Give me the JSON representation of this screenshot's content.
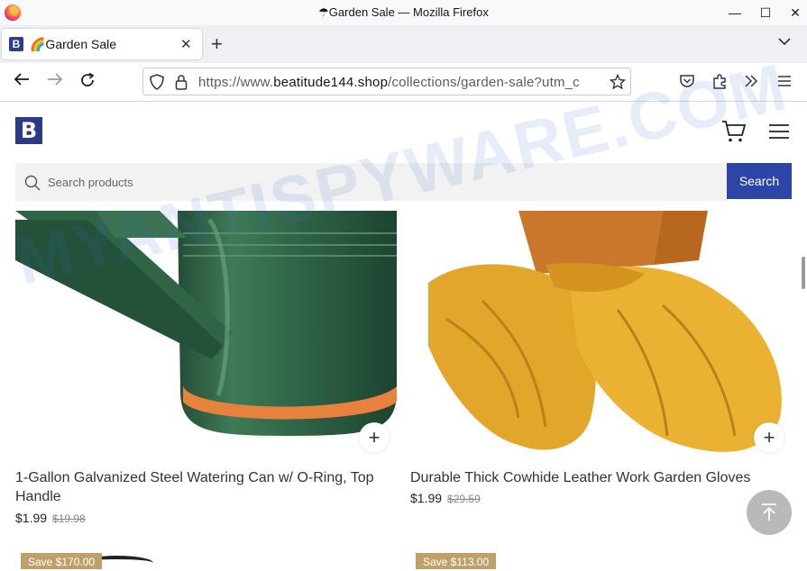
{
  "window": {
    "title": "☂Garden Sale — Mozilla Firefox"
  },
  "tab": {
    "title": "🌈Garden Sale",
    "favicon_letter": "B"
  },
  "navbar": {
    "url_prefix": "https://www.",
    "url_domain": "beatitude144.shop",
    "url_suffix": "/collections/garden-sale?utm_c"
  },
  "site": {
    "logo_letter": "B",
    "search": {
      "placeholder": "Search products",
      "button_label": "Search"
    }
  },
  "products": [
    {
      "title": "1-Gallon Galvanized Steel Watering Can w/ O-Ring, Top Handle",
      "price": "$1.99",
      "compare_price": "$19.98"
    },
    {
      "title": "Durable Thick Cowhide Leather Work Garden Gloves",
      "price": "$1.99",
      "compare_price": "$29.59"
    }
  ],
  "badges": [
    "Save $170.00",
    "Save $113.00"
  ],
  "watermark": "MYANTISPYWARE.COM",
  "colors": {
    "accent": "#2d45a7",
    "logo": "#2c3a8a",
    "badge": "#c0a06a"
  }
}
